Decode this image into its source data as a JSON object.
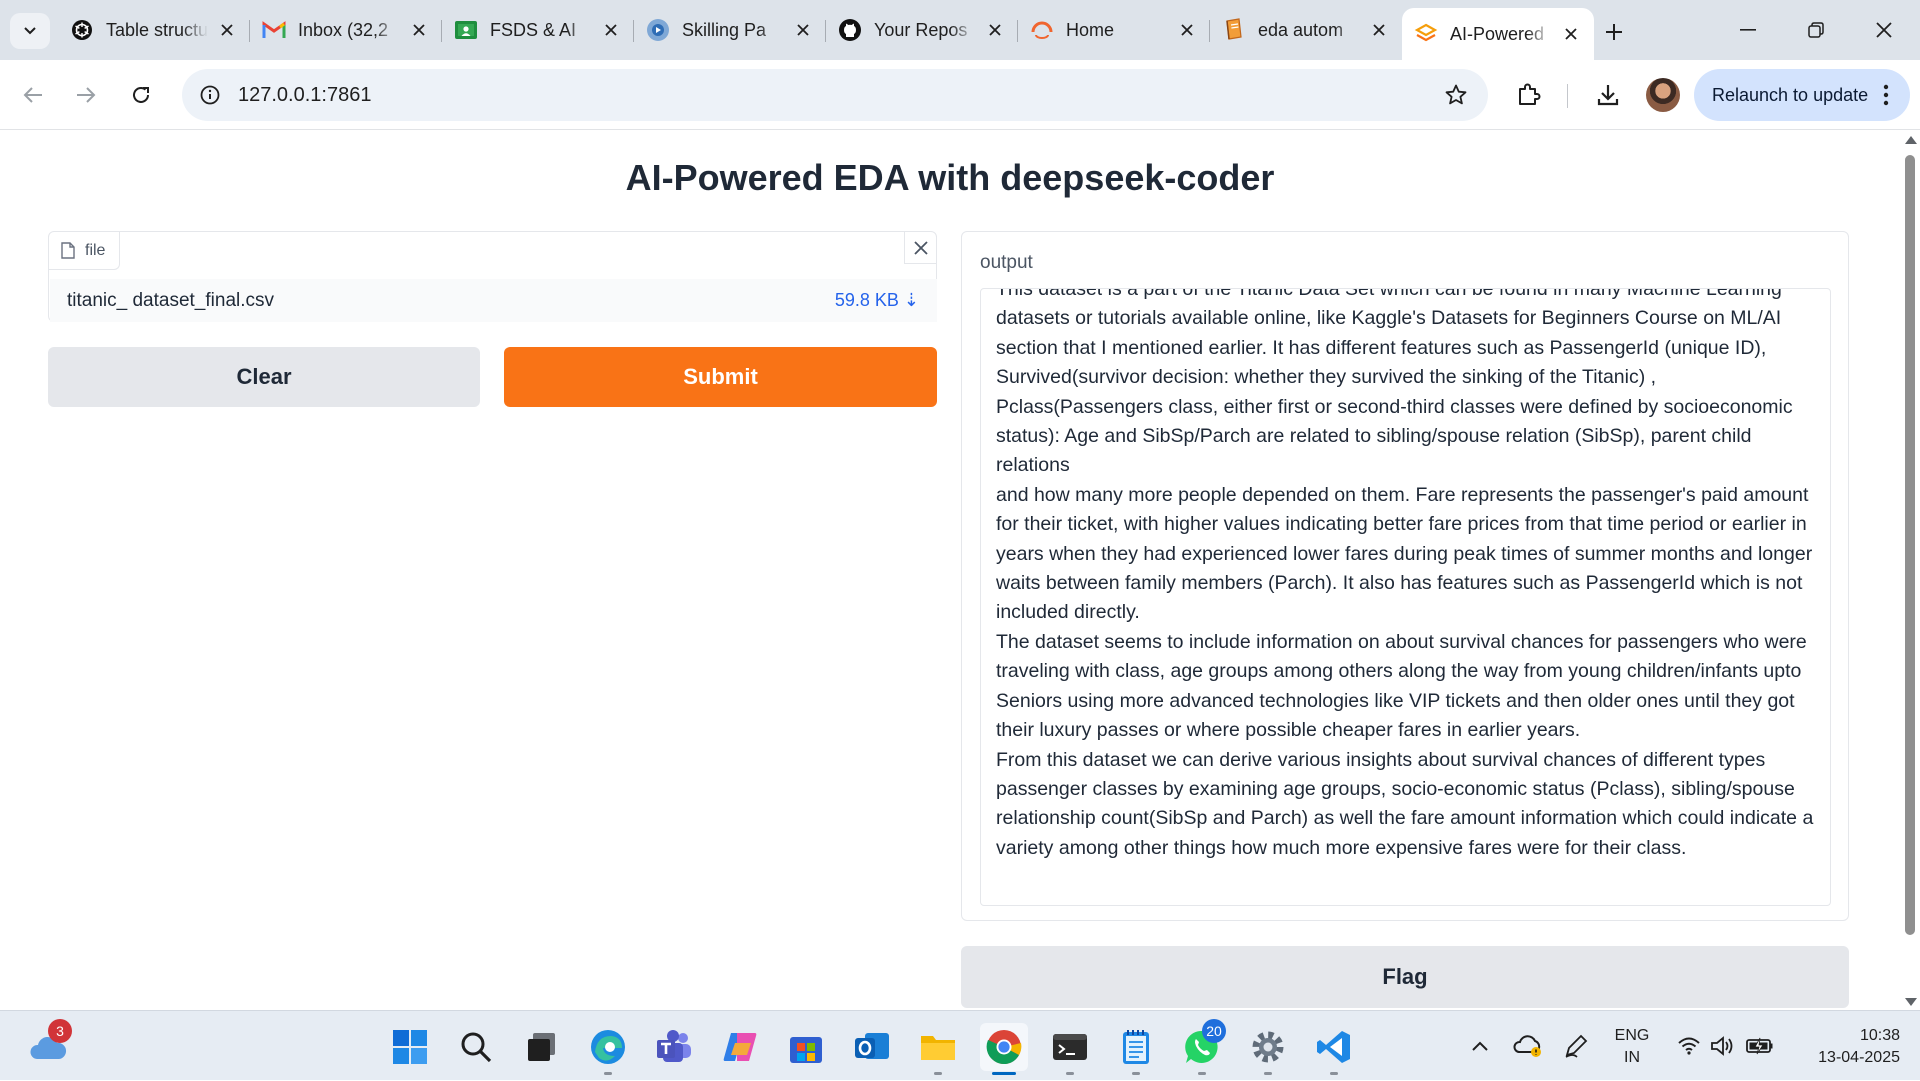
{
  "browser": {
    "tabs": [
      {
        "title": "Table structure",
        "icon": "openai-icon"
      },
      {
        "title": "Inbox (32,2",
        "icon": "gmail-icon"
      },
      {
        "title": "FSDS & AI",
        "icon": "classroom-icon"
      },
      {
        "title": "Skilling Pa",
        "icon": "skilling-icon"
      },
      {
        "title": "Your Repos",
        "icon": "github-icon"
      },
      {
        "title": "Home",
        "icon": "home-icon"
      },
      {
        "title": "eda autom",
        "icon": "book-icon"
      },
      {
        "title": "AI-Powered",
        "icon": "gradio-icon"
      }
    ],
    "active_tab_index": 7,
    "url": "127.0.0.1:7861",
    "relaunch_label": "Relaunch to update"
  },
  "app": {
    "title": "AI-Powered EDA with deepseek-coder",
    "file_input": {
      "label": "file",
      "file_name": "titanic_ dataset_final.csv",
      "file_size": "59.8 KB ⇣"
    },
    "buttons": {
      "clear": "Clear",
      "submit": "Submit",
      "flag": "Flag"
    },
    "output": {
      "label": "output",
      "paragraphs": [
        "This dataset is a part of the Titanic Data Set which can be found in many Machine Learning datasets or tutorials available online, like Kaggle's Datasets for Beginners Course on ML/AI section that I mentioned earlier.  It has different features such as PassengerId (unique ID), Survived(survivor decision: whether they survived the sinking of the Titanic) , Pclass(Passengers class, either first or second-third classes were defined by socioeconomic status): Age and SibSp/Parch are related to sibling/spouse relation (SibSp), parent child relations",
        "and how many more people depended on them. Fare represents the passenger's paid amount for their ticket, with higher values indicating better fare prices from that time period or earlier in years when they had experienced lower fares during peak times of summer months and longer waits between family members (Parch). It also has features such as PassengerId which is not included directly.",
        "The dataset seems to include information on about survival chances for passengers who were traveling with class, age groups among others along the way from young children/infants upto Seniors using more advanced technologies like VIP tickets and then older ones until they got their luxury passes or where possible cheaper fares in earlier years.",
        "From this dataset we can derive various insights about survival chances of different types passenger classes by examining age groups, socio-economic status (Pclass), sibling/spouse relationship count(SibSp and Parch) as well the fare amount information which could indicate a variety among other things how much more expensive fares were for their class."
      ]
    }
  },
  "taskbar": {
    "weather_badge": "3",
    "whatsapp_badge": "20",
    "language_line1": "ENG",
    "language_line2": "IN",
    "time": "10:38",
    "date": "13-04-2025",
    "accent": "#0067c0"
  }
}
